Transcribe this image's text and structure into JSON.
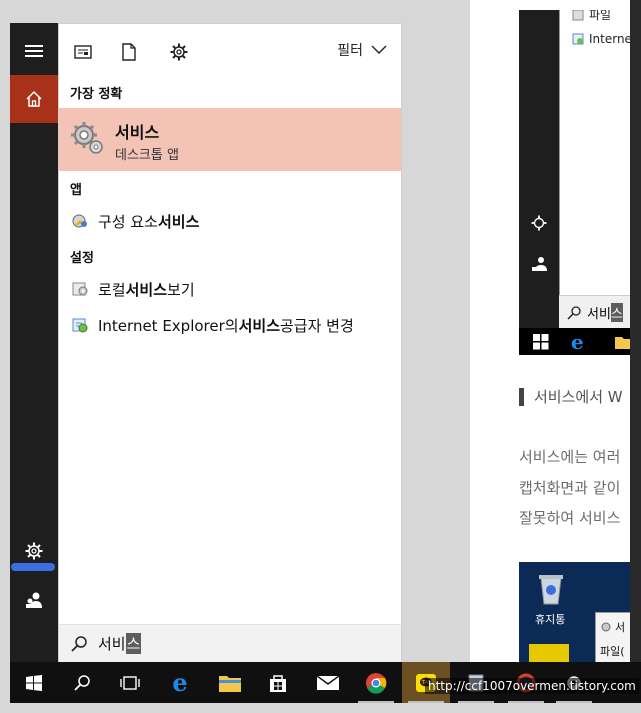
{
  "start_menu": {
    "top_icons": [
      "document-icon",
      "file-icon",
      "gear-icon"
    ],
    "filter_label": "필터",
    "best_match": {
      "heading": "가장 정확",
      "title": "서비스",
      "subtitle": "데스크톱 앱"
    },
    "apps": {
      "heading": "앱",
      "items": [
        {
          "prefix": "구성 요소 ",
          "bold": "서비스",
          "suffix": ""
        }
      ]
    },
    "settings": {
      "heading": "설정",
      "items": [
        {
          "prefix": "로컬 ",
          "bold": "서비스",
          "suffix": " 보기"
        },
        {
          "prefix": "Internet Explorer의 ",
          "bold": "서비스",
          "suffix": " 공급자 변경"
        }
      ]
    },
    "search": {
      "typed": "서비",
      "composing": "스"
    }
  },
  "document": {
    "shot_top_items": [
      "파일",
      "Internet"
    ],
    "shot_search_text": "서비",
    "shot_search_cursor": "스",
    "heading": "서비스에서 W",
    "lines": [
      "서비스에는 여러",
      "캡처화면과 같이",
      "잘못하여 서비스"
    ],
    "shot2_recycle_label": "휴지통",
    "shot2_popup": [
      "서",
      "파일("
    ]
  },
  "taskbar": {
    "url": "http://ccf1007overmen.tistory.com"
  },
  "colors": {
    "accent_home": "#a8311a",
    "best_match_bg": "#f3c3b5",
    "pen_mark": "#3b6fe0"
  }
}
